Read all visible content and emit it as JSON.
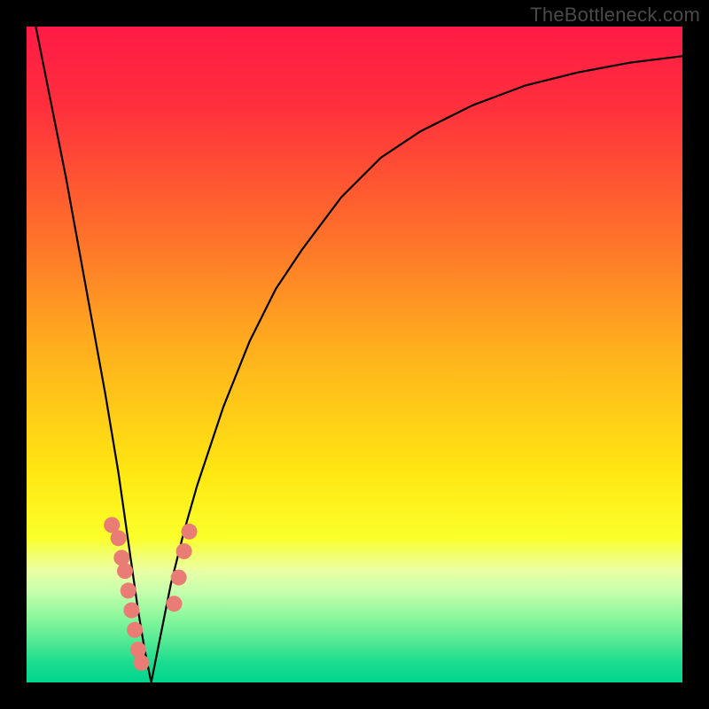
{
  "watermark": "TheBottleneck.com",
  "chart_data": {
    "type": "line",
    "title": "",
    "xlabel": "",
    "ylabel": "",
    "xlim": [
      0,
      100
    ],
    "ylim": [
      0,
      100
    ],
    "curve_min_x": 19,
    "series": [
      {
        "name": "bottleneck-curve",
        "x": [
          0,
          2,
          4,
          6,
          8,
          10,
          12,
          14,
          16,
          17,
          18,
          19,
          20,
          21,
          22,
          24,
          26,
          28,
          30,
          34,
          38,
          42,
          48,
          54,
          60,
          68,
          76,
          84,
          92,
          100
        ],
        "values": [
          107,
          97,
          87,
          77,
          66,
          55,
          44,
          32,
          18,
          11,
          5,
          0,
          5,
          10,
          15,
          23,
          30,
          36,
          42,
          52,
          60,
          66,
          74,
          80,
          84,
          88,
          91,
          93,
          94.5,
          95.5
        ]
      }
    ],
    "highlight_band": {
      "y_top": 24,
      "y_bottom": 0
    },
    "highlight_points": {
      "color": "#e97c74",
      "left": [
        {
          "x": 13.0,
          "y": 24
        },
        {
          "x": 14.0,
          "y": 22
        },
        {
          "x": 14.5,
          "y": 19
        },
        {
          "x": 15.0,
          "y": 17
        },
        {
          "x": 15.5,
          "y": 14
        },
        {
          "x": 16.0,
          "y": 11
        },
        {
          "x": 16.5,
          "y": 8
        },
        {
          "x": 17.0,
          "y": 5
        },
        {
          "x": 17.5,
          "y": 3
        }
      ],
      "right": [
        {
          "x": 22.5,
          "y": 12
        },
        {
          "x": 23.2,
          "y": 16
        },
        {
          "x": 24.0,
          "y": 20
        },
        {
          "x": 24.8,
          "y": 23
        }
      ]
    },
    "gradient_stops": [
      {
        "offset": 0.0,
        "color": "#ff1a46"
      },
      {
        "offset": 0.12,
        "color": "#ff2f3d"
      },
      {
        "offset": 0.3,
        "color": "#ff6a2c"
      },
      {
        "offset": 0.5,
        "color": "#ffb21d"
      },
      {
        "offset": 0.68,
        "color": "#ffe712"
      },
      {
        "offset": 0.78,
        "color": "#fbff2a"
      },
      {
        "offset": 0.8,
        "color": "#f4ff60"
      },
      {
        "offset": 0.83,
        "color": "#eaffa5"
      },
      {
        "offset": 0.86,
        "color": "#c8ffad"
      },
      {
        "offset": 0.9,
        "color": "#8cf79c"
      },
      {
        "offset": 0.94,
        "color": "#4ee893"
      },
      {
        "offset": 0.97,
        "color": "#1bdc8f"
      },
      {
        "offset": 1.0,
        "color": "#00d58e"
      }
    ]
  }
}
